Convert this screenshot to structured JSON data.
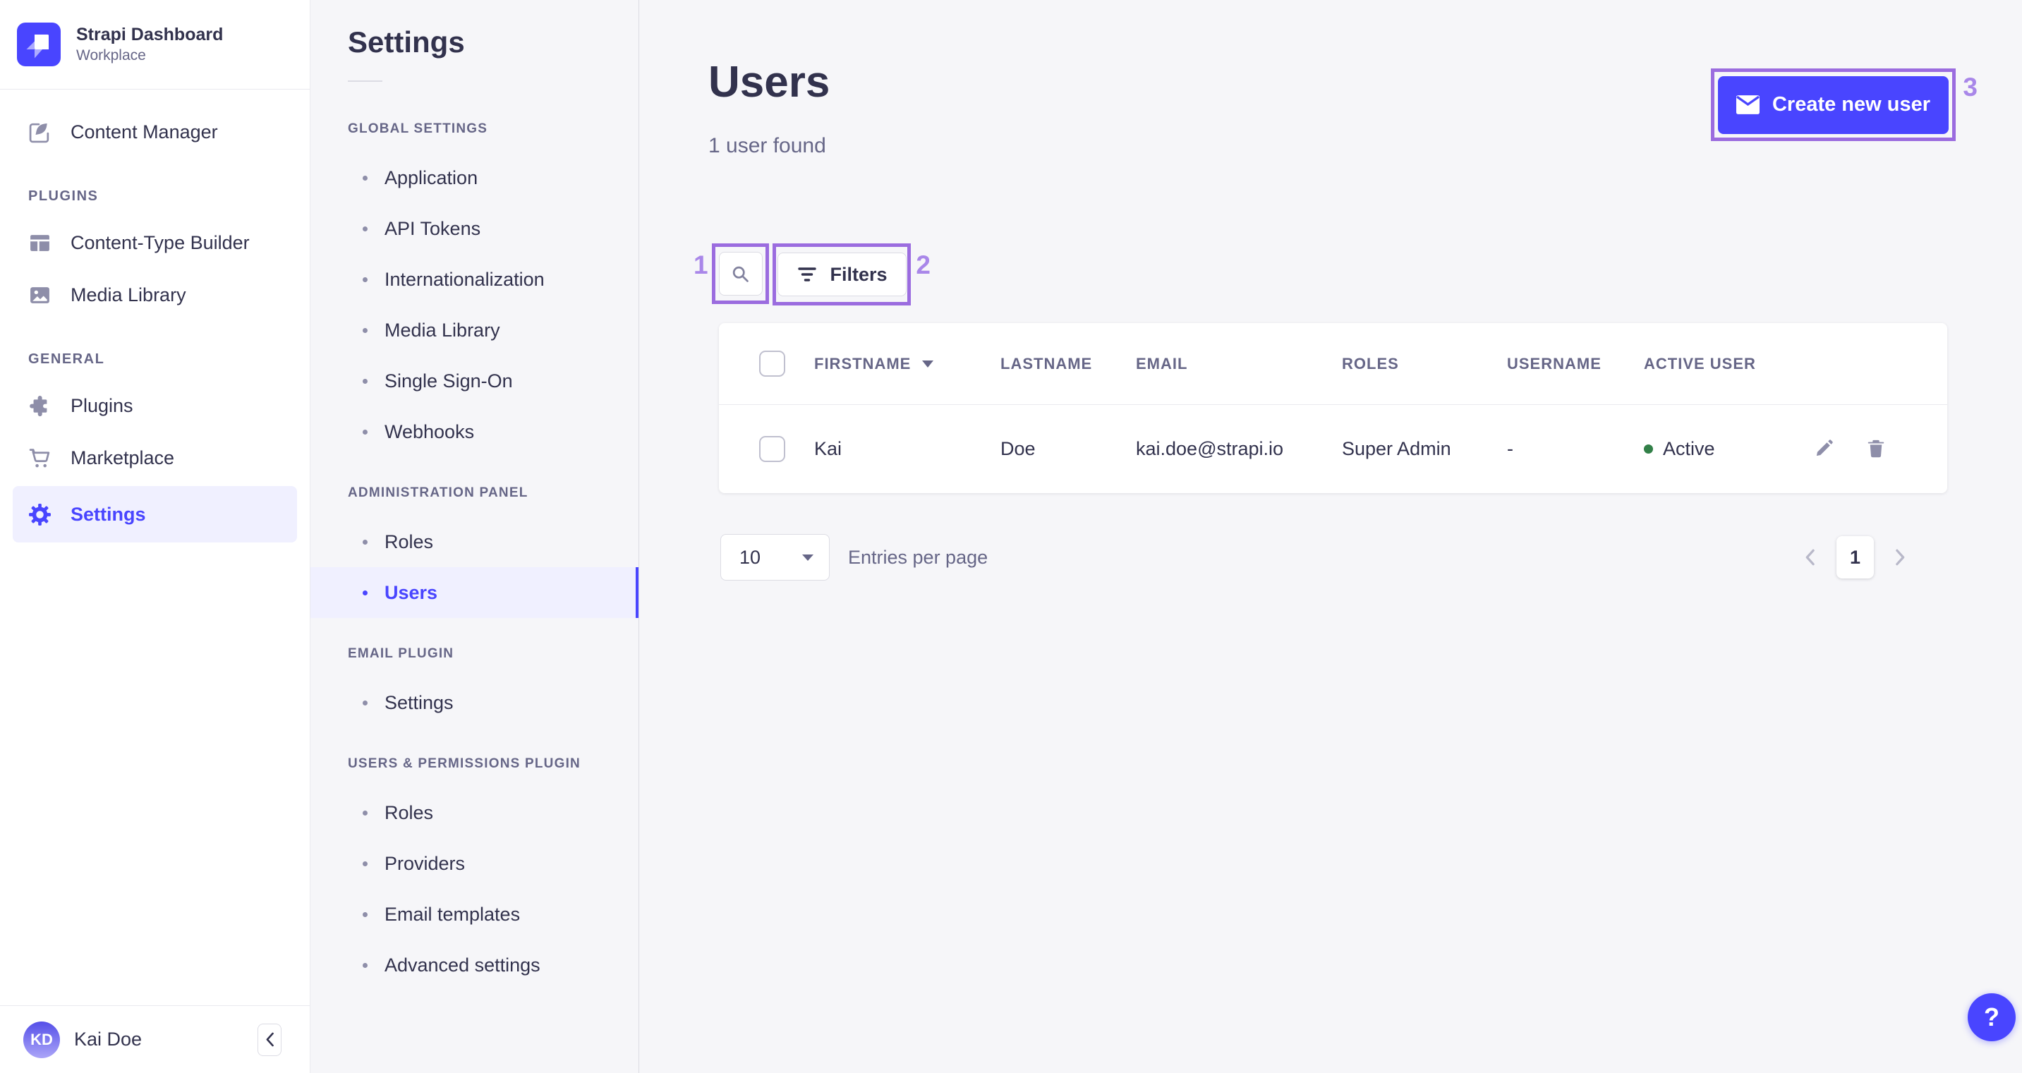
{
  "colors": {
    "brand": "#4945ff",
    "active_bg": "#f0f0ff",
    "annotation_border": "#9b6cdf",
    "annotation_label": "#a987e9",
    "success_dot": "#328048",
    "text_dark": "#32324d",
    "text_muted": "#666687",
    "page_bg": "#f6f6f9"
  },
  "icons": {
    "brand": "strapi-logo",
    "content_manager": "pen-square-icon",
    "content_type_builder": "layout-icon",
    "media_library": "picture-icon",
    "plugins": "puzzle-icon",
    "marketplace": "cart-icon",
    "settings": "gear-icon",
    "search": "search-icon",
    "filters": "filter-bars-icon",
    "create_user": "envelope-icon",
    "edit": "pencil-icon",
    "delete": "trash-icon",
    "collapse": "chevron-left-icon",
    "pager_prev": "chevron-left-icon",
    "pager_next": "chevron-right-icon",
    "sort": "caret-down-icon",
    "help": "question-mark"
  },
  "sidebar": {
    "brand": {
      "title": "Strapi Dashboard",
      "subtitle": "Workplace"
    },
    "content_manager": "Content Manager",
    "sections": [
      {
        "title": "PLUGINS",
        "items": [
          "Content-Type Builder",
          "Media Library"
        ]
      },
      {
        "title": "GENERAL",
        "items": [
          "Plugins",
          "Marketplace",
          "Settings"
        ]
      }
    ],
    "footer": {
      "initials": "KD",
      "name": "Kai Doe"
    }
  },
  "settings_nav": {
    "title": "Settings",
    "active_item": "Users",
    "groups": [
      {
        "title": "GLOBAL SETTINGS",
        "items": [
          "Application",
          "API Tokens",
          "Internationalization",
          "Media Library",
          "Single Sign-On",
          "Webhooks"
        ]
      },
      {
        "title": "ADMINISTRATION PANEL",
        "items": [
          "Roles",
          "Users"
        ]
      },
      {
        "title": "EMAIL PLUGIN",
        "items": [
          "Settings"
        ]
      },
      {
        "title": "USERS & PERMISSIONS PLUGIN",
        "items": [
          "Roles",
          "Providers",
          "Email templates",
          "Advanced settings"
        ]
      }
    ]
  },
  "main": {
    "title": "Users",
    "subtitle": "1 user found",
    "create_label": "Create new user",
    "filters_label": "Filters",
    "table": {
      "headers": [
        "FIRSTNAME",
        "LASTNAME",
        "EMAIL",
        "ROLES",
        "USERNAME",
        "ACTIVE USER"
      ],
      "row": {
        "firstname": "Kai",
        "lastname": "Doe",
        "email": "kai.doe@strapi.io",
        "roles": "Super Admin",
        "username": "-",
        "status": "Active"
      }
    },
    "pagination": {
      "page_size": "10",
      "entries_label": "Entries per page",
      "page": "1"
    },
    "help_label": "?"
  },
  "annotations": [
    "1",
    "2",
    "3"
  ]
}
